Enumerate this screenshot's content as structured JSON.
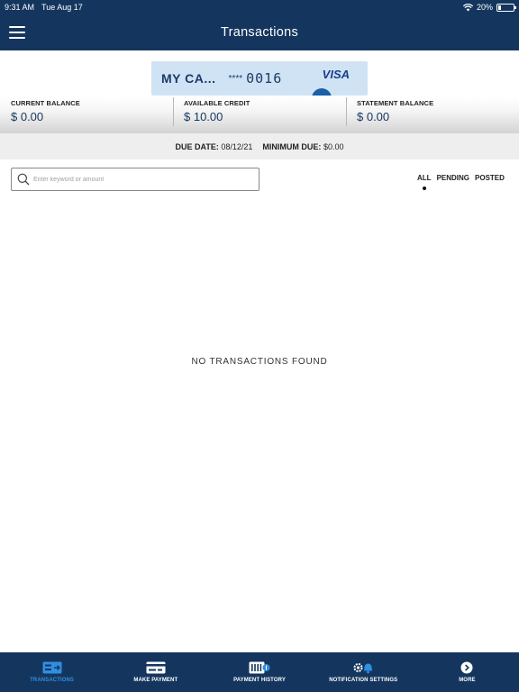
{
  "status": {
    "time": "9:31 AM",
    "date": "Tue Aug 17",
    "battery": "20%",
    "battery_level": 0.2
  },
  "header": {
    "title": "Transactions"
  },
  "card": {
    "name": "MY CA...",
    "mask": "****",
    "last4": "0016",
    "brand": "VISA"
  },
  "balances": [
    {
      "label": "CURRENT BALANCE",
      "value": "$ 0.00"
    },
    {
      "label": "AVAILABLE CREDIT",
      "value": "$ 10.00"
    },
    {
      "label": "STATEMENT BALANCE",
      "value": "$ 0.00"
    }
  ],
  "due": {
    "due_label": "DUE DATE:",
    "due_value": "08/12/21",
    "min_label": "MINIMUM DUE:",
    "min_value": "$0.00"
  },
  "search": {
    "placeholder": "Enter keyword or amount"
  },
  "filters": {
    "all": "ALL",
    "pending": "PENDING",
    "posted": "POSTED",
    "selected": "ALL"
  },
  "empty_message": "NO TRANSACTIONS FOUND",
  "tabs": [
    {
      "label": "TRANSACTIONS",
      "icon": "transactions-icon",
      "active": true
    },
    {
      "label": "MAKE PAYMENT",
      "icon": "card-icon",
      "active": false
    },
    {
      "label": "PAYMENT HISTORY",
      "icon": "payment-history-icon",
      "active": false
    },
    {
      "label": "NOTIFICATION SETTINGS",
      "icon": "notification-settings-icon",
      "active": false
    },
    {
      "label": "MORE",
      "icon": "more-icon",
      "active": false
    }
  ],
  "colors": {
    "navy": "#14365e",
    "accent": "#2f8fe0",
    "card": "#cfe3f4"
  }
}
